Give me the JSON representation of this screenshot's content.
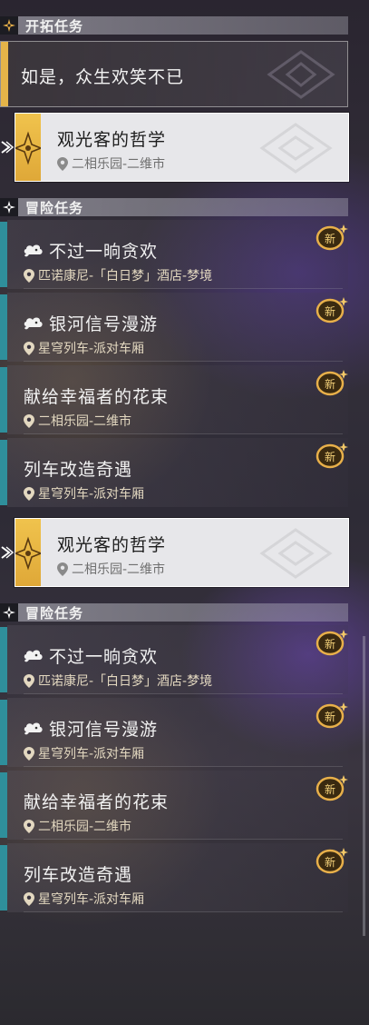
{
  "trailblaze_header": {
    "title": "开拓任务"
  },
  "trailblaze_quest": {
    "title": "如是，众生欢笑不已"
  },
  "selected_quest_top": {
    "title": "观光客的哲学",
    "location": "二相乐园-二维市"
  },
  "adventure_header_top": {
    "title": "冒险任务"
  },
  "adventure_quests_top": [
    {
      "title": "不过一晌贪欢",
      "location": "匹诺康尼-「白日梦」酒店-梦境",
      "badge": "新",
      "has_icon": true
    },
    {
      "title": "银河信号漫游",
      "location": "星穹列车-派对车厢",
      "badge": "新",
      "has_icon": true
    },
    {
      "title": "献给幸福者的花束",
      "location": "二相乐园-二维市",
      "badge": "新",
      "has_icon": false
    },
    {
      "title": "列车改造奇遇",
      "location": "星穹列车-派对车厢",
      "badge": "新",
      "has_icon": false
    }
  ],
  "selected_quest_bottom": {
    "title": "观光客的哲学",
    "location": "二相乐园-二维市"
  },
  "adventure_header_bottom": {
    "title": "冒险任务"
  },
  "adventure_quests_bottom": [
    {
      "title": "不过一晌贪欢",
      "location": "匹诺康尼-「白日梦」酒店-梦境",
      "badge": "新",
      "has_icon": true
    },
    {
      "title": "银河信号漫游",
      "location": "星穹列车-派对车厢",
      "badge": "新",
      "has_icon": true
    },
    {
      "title": "献给幸福者的花束",
      "location": "二相乐园-二维市",
      "badge": "新",
      "has_icon": false
    },
    {
      "title": "列车改造奇遇",
      "location": "星穹列车-派对车厢",
      "badge": "新",
      "has_icon": false
    }
  ],
  "colors": {
    "accent_gold": "#e5b449",
    "quest_bar_teal": "#2f8f9b",
    "selected_card": "#e7e7ea"
  },
  "icons": {
    "section": "compass-star-icon",
    "location": "map-pin-icon",
    "quest_type": "cloud-cat-icon",
    "new": "new-badge-icon"
  }
}
